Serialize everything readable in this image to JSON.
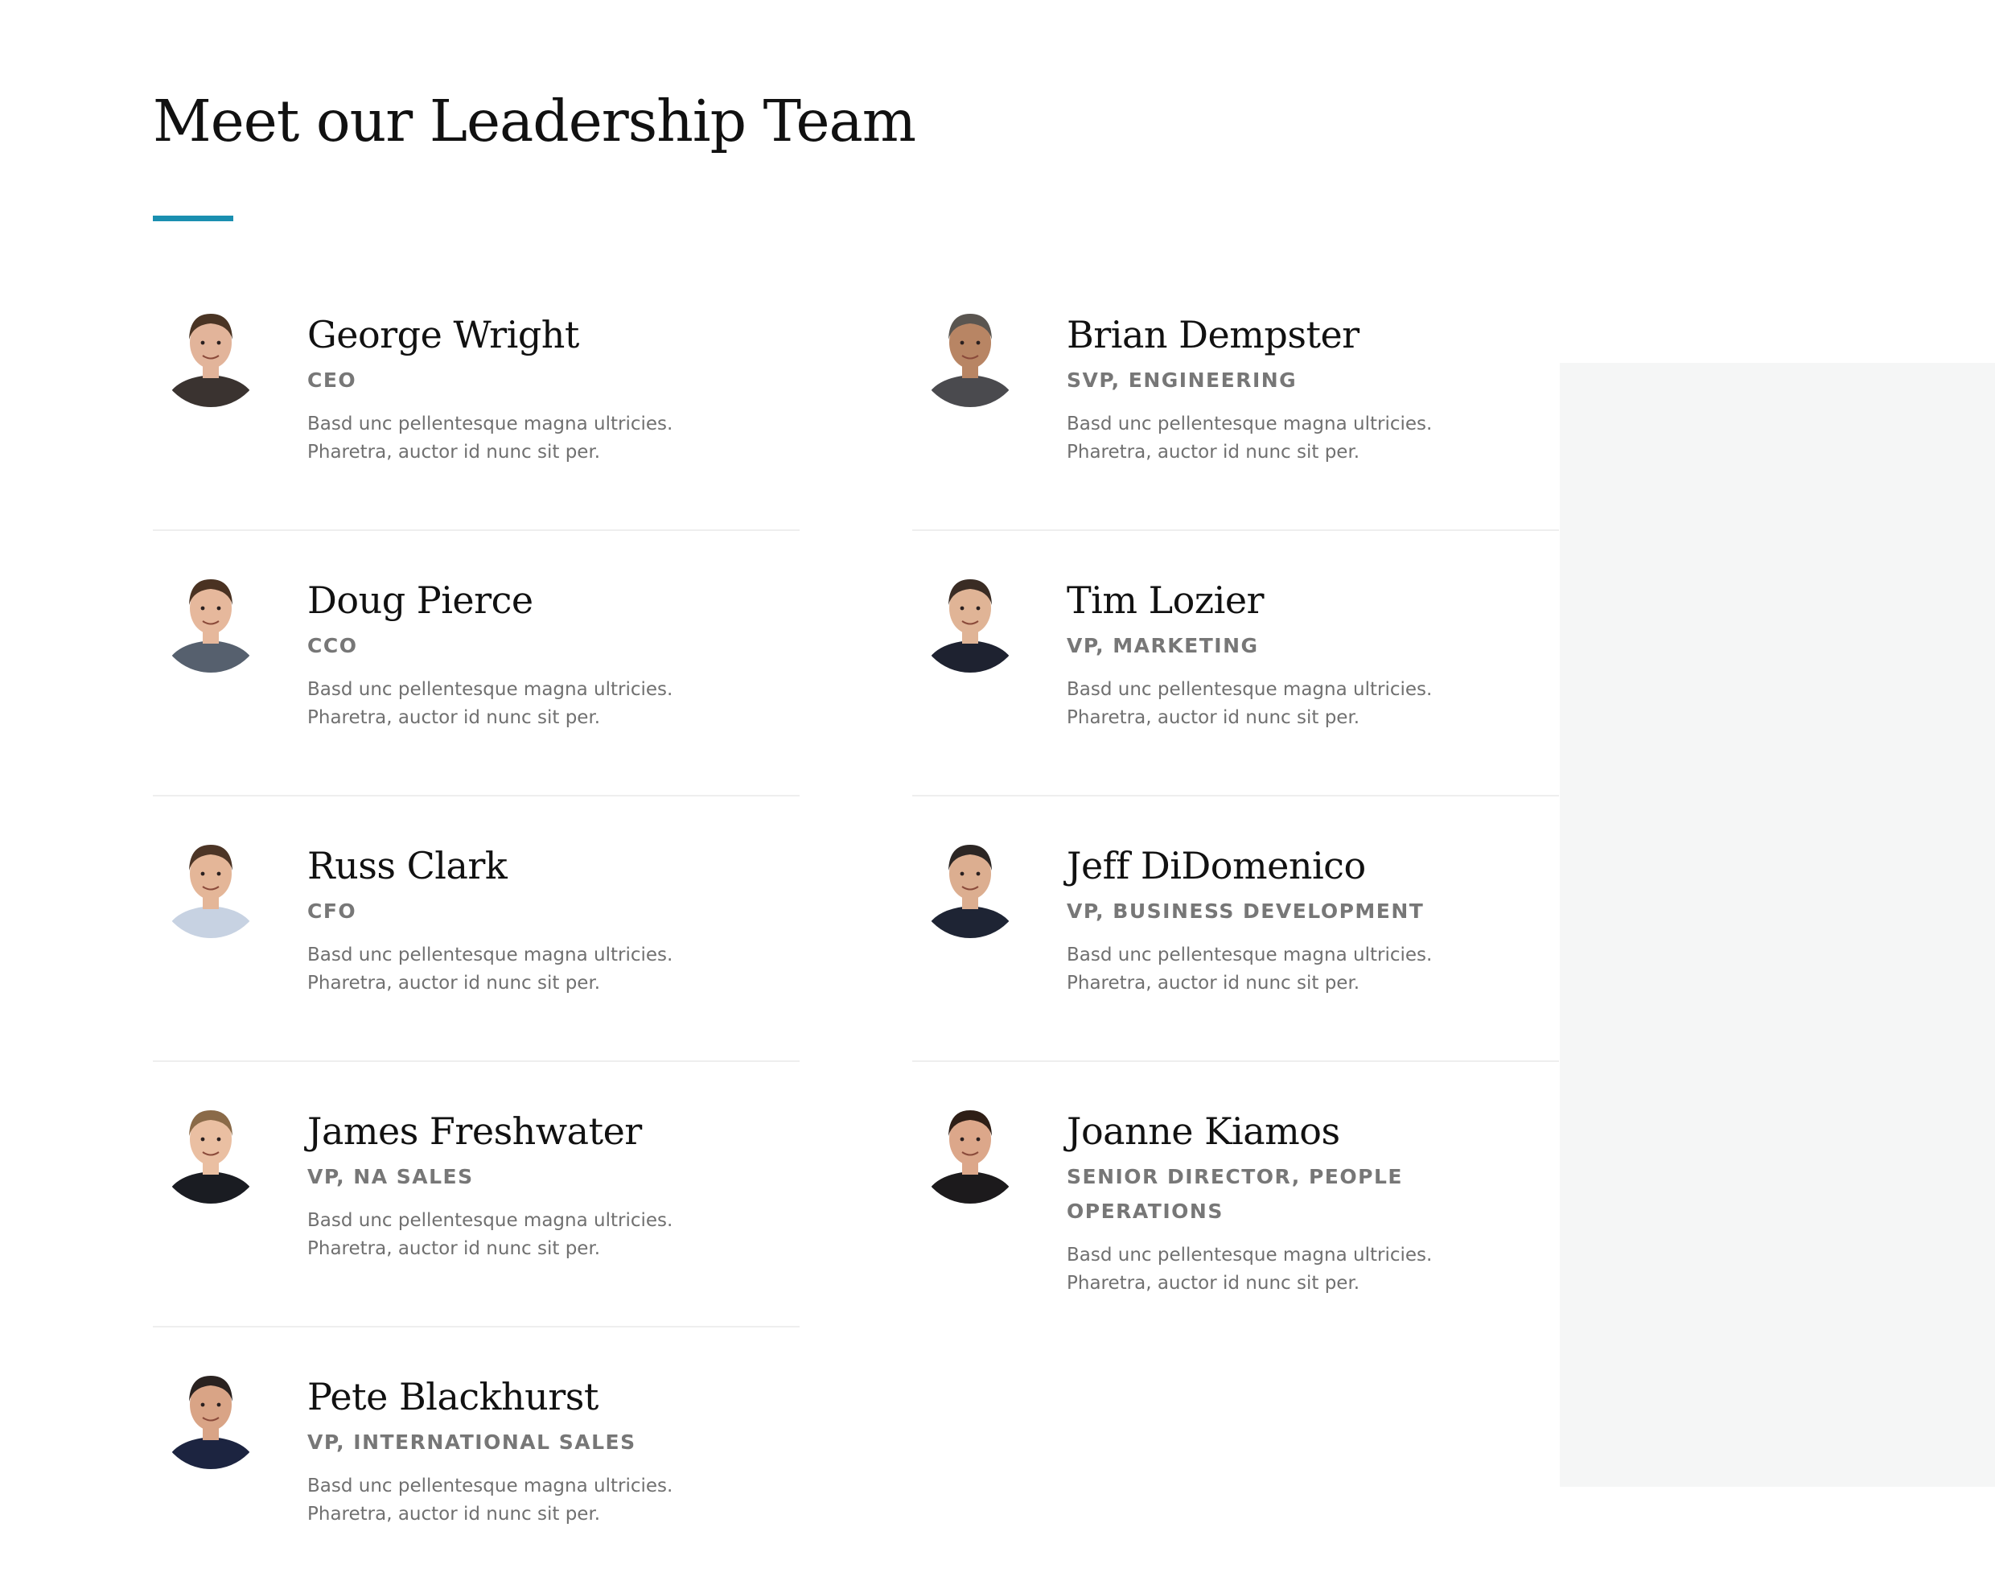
{
  "page": {
    "title": "Meet our Leadership Team"
  },
  "colors": {
    "accent": "#1a8fb0",
    "panel": "#f5f6f6",
    "divider": "#eeeeee"
  },
  "team": [
    {
      "name": "George Wright",
      "role": "CEO",
      "bio": "Basd unc pellentesque magna ultricies. Pharetra, auctor id nunc sit per.",
      "avatar_icon": "person-portrait-icon",
      "skin": "#e2b49a",
      "hair": "#4a3424",
      "shirt": "#3a3330"
    },
    {
      "name": "Brian Dempster",
      "role": "SVP, Engineering",
      "bio": "Basd unc pellentesque magna ultricies. Pharetra, auctor id nunc sit per.",
      "avatar_icon": "person-portrait-icon",
      "skin": "#b88564",
      "hair": "#5a5550",
      "shirt": "#4a4a4e"
    },
    {
      "name": "Doug Pierce",
      "role": "CCO",
      "bio": "Basd unc pellentesque magna ultricies. Pharetra, auctor id nunc sit per.",
      "avatar_icon": "person-portrait-icon",
      "skin": "#e6b89c",
      "hair": "#4a3222",
      "shirt": "#56606e"
    },
    {
      "name": "Tim Lozier",
      "role": "VP, Marketing",
      "bio": "Basd unc pellentesque magna ultricies. Pharetra, auctor id nunc sit per.",
      "avatar_icon": "person-portrait-icon",
      "skin": "#e0b496",
      "hair": "#3a2c24",
      "shirt": "#1e2230"
    },
    {
      "name": "Russ Clark",
      "role": "CFO",
      "bio": "Basd unc pellentesque magna ultricies. Pharetra, auctor id nunc sit per.",
      "avatar_icon": "person-portrait-icon",
      "skin": "#e4b698",
      "hair": "#4c3526",
      "shirt": "#c7d2e2"
    },
    {
      "name": "Jeff DiDomenico",
      "role": "VP, Business Development",
      "bio": "Basd unc pellentesque magna ultricies. Pharetra, auctor id nunc sit per.",
      "avatar_icon": "person-portrait-icon",
      "skin": "#dcae90",
      "hair": "#2c2624",
      "shirt": "#1e2434"
    },
    {
      "name": "James Freshwater",
      "role": "VP, NA Sales",
      "bio": "Basd unc pellentesque magna ultricies. Pharetra, auctor id nunc sit per.",
      "avatar_icon": "person-portrait-icon",
      "skin": "#eabfa2",
      "hair": "#8a6a48",
      "shirt": "#1a1c22"
    },
    {
      "name": "Joanne Kiamos",
      "role": "Senior Director, People Operations",
      "bio": "Basd unc pellentesque magna ultricies. Pharetra, auctor id nunc sit per.",
      "avatar_icon": "person-portrait-icon",
      "skin": "#dca78a",
      "hair": "#2e1e16",
      "shirt": "#1c1a1c"
    },
    {
      "name": "Pete Blackhurst",
      "role": "VP, International Sales",
      "bio": "Basd unc pellentesque magna ultricies. Pharetra, auctor id nunc sit per.",
      "avatar_icon": "person-portrait-icon",
      "skin": "#d9a486",
      "hair": "#2a2220",
      "shirt": "#1c2440"
    }
  ]
}
